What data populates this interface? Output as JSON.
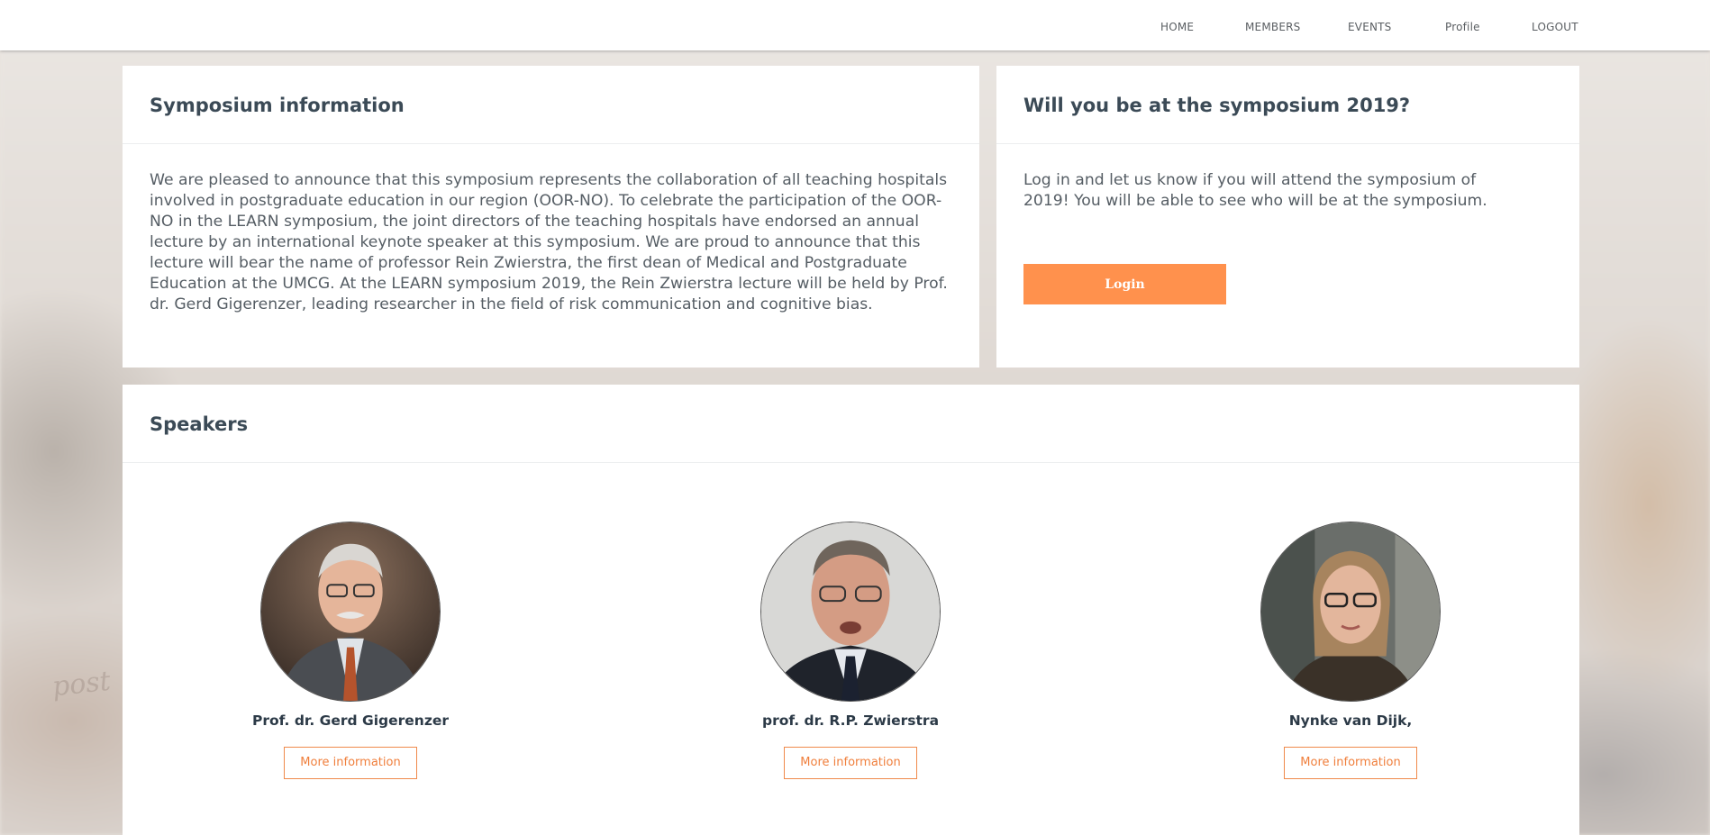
{
  "nav": {
    "home": "HOME",
    "members": "MEMBERS",
    "events": "EVENTS",
    "profile": "Profile",
    "logout": "LOGOUT"
  },
  "info": {
    "title": "Symposium information",
    "body": "We are pleased to announce that this symposium represents the collaboration of all teaching hospitals involved in postgraduate education in our region (OOR-NO). To celebrate the participation of the OOR- NO in the LEARN symposium, the joint directors of the teaching hospitals have endorsed an annual lecture by an international keynote speaker at this symposium. We are proud to announce that this lecture will bear the name of professor Rein Zwierstra, the first dean of Medical and Postgraduate Education at the UMCG. At the LEARN symposium 2019, the Rein Zwierstra lecture will be held by Prof. dr. Gerd Gigerenzer, leading researcher in the field of risk communication and cognitive bias."
  },
  "attend": {
    "title": "Will you be at the symposium 2019?",
    "body": "Log in and let us know if you will attend the symposium of 2019! You will be able to see who will be at the symposium.",
    "login_label": "Login"
  },
  "speakers": {
    "title": "Speakers",
    "more_label": "More information",
    "items": [
      {
        "name": "Prof. dr. Gerd Gigerenzer"
      },
      {
        "name": "prof. dr. R.P. Zwierstra"
      },
      {
        "name": "Nynke van Dijk,"
      }
    ]
  },
  "colors": {
    "accent": "#ff914d",
    "heading": "#3b4a56"
  }
}
